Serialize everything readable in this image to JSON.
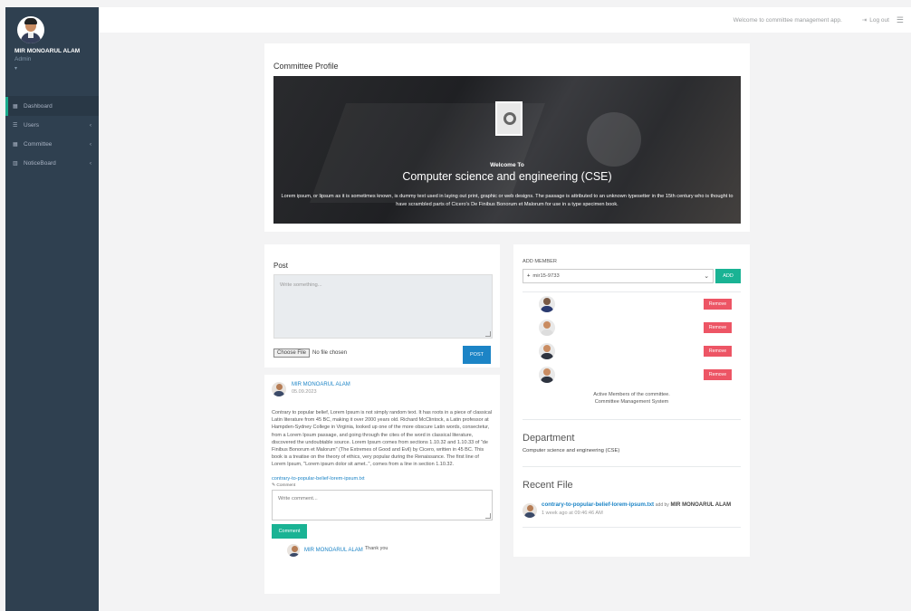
{
  "sidebar": {
    "user_name": "MIR MONOARUL ALAM",
    "user_role": "Admin",
    "items": [
      {
        "icon": "grid-icon",
        "label": "Dashboard",
        "arrow": ""
      },
      {
        "icon": "list-icon",
        "label": "Users",
        "arrow": "‹"
      },
      {
        "icon": "grid-icon",
        "label": "Committee",
        "arrow": "‹"
      },
      {
        "icon": "bar-chart-icon",
        "label": "NoticeBoard",
        "arrow": "‹"
      }
    ]
  },
  "topbar": {
    "welcome": "Welcome to committee management app.",
    "logout": "Log out"
  },
  "committee_profile": {
    "title": "Committee Profile",
    "welcome_to": "Welcome To",
    "department": "Computer science and engineering (CSE)",
    "description": "Lorem ipsum, or lipsum as it is sometimes known, is dummy text used in laying out print, graphic or web designs. The passage is attributed to an unknown typesetter in the 15th century who is thought to have scrambled parts of Cicero's De Finibus Bonorum et Malorum for use in a type specimen book."
  },
  "post_form": {
    "title": "Post",
    "placeholder": "Write something...",
    "choose_file": "Choose File",
    "no_file": "No file chosen",
    "post_button": "POST"
  },
  "feed_post": {
    "author": "MIR MONOARUL ALAM",
    "date": "05.09.2023",
    "text": "Contrary to popular belief, Lorem Ipsum is not simply random text. It has roots in a piece of classical Latin literature from 45 BC, making it over 2000 years old. Richard McClintock, a Latin professor at Hampden-Sydney College in Virginia, looked up one of the more obscure Latin words, consectetur, from a Lorem Ipsum passage, and going through the cites of the word in classical literature, discovered the undoubtable source. Lorem Ipsum comes from sections 1.10.32 and 1.10.33 of \"de Finibus Bonorum et Malorum\" (The Extremes of Good and Evil) by Cicero, written in 45 BC. This book is a treatise on the theory of ethics, very popular during the Renaissance. The first line of Lorem Ipsum, \"Lorem ipsum dolor sit amet..\", comes from a line in section 1.10.32.",
    "attachment": "contrary-to-popular-belief-lorem-ipsum.txt",
    "comment_label": "Comment",
    "comment_placeholder": "Write comment...",
    "comment_button": "Comment",
    "comments": [
      {
        "author": "MIR MONOARUL ALAM",
        "text": "Thank you"
      }
    ]
  },
  "members": {
    "add_label": "ADD MEMBER",
    "selected": "mir15-9733",
    "add_button": "ADD",
    "list": [
      {
        "avatar": "female-avatar",
        "action": "Remove"
      },
      {
        "avatar": "male-avatar",
        "action": "Remove"
      },
      {
        "avatar": "male-avatar",
        "action": "Remove"
      },
      {
        "avatar": "male-suit-avatar",
        "action": "Remove"
      }
    ],
    "footer_line1": "Active Members of the committee.",
    "footer_line2": "Committee Management System"
  },
  "department": {
    "title": "Department",
    "value": "Computer science and engineering (CSE)"
  },
  "recent_file": {
    "title": "Recent File",
    "file": "contrary-to-popular-belief-lorem-ipsum.txt",
    "by_label": "add by",
    "author": "MIR MONOARUL ALAM",
    "time": "1 week ago at 09:46:46 AM"
  }
}
